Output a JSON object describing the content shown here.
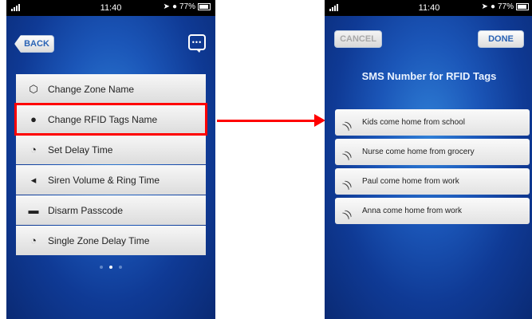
{
  "status_bar": {
    "time": "11:40",
    "battery": "77%"
  },
  "left_screen": {
    "back_label": "BACK",
    "chat_icon": "chat-bubble-icon",
    "menu_items": [
      {
        "label": "Change Zone Name",
        "icon": "zone-icon"
      },
      {
        "label": "Change RFID Tags Name",
        "icon": "person-icon"
      },
      {
        "label": "Set Delay Time",
        "icon": "clock-icon"
      },
      {
        "label": "Siren Volume & Ring Time",
        "icon": "speaker-icon"
      },
      {
        "label": "Disarm Passcode",
        "icon": "lock-icon"
      },
      {
        "label": "Single Zone Delay Time",
        "icon": "clock-icon"
      }
    ],
    "page_dots": 3,
    "active_dot": 1
  },
  "right_screen": {
    "cancel_label": "CANCEL",
    "done_label": "DONE",
    "title": "SMS Number for RFID Tags",
    "tags": [
      {
        "label": "Kids come home from school",
        "icon": "rfid-signal-icon"
      },
      {
        "label": "Nurse come home from grocery",
        "icon": "rfid-signal-icon"
      },
      {
        "label": "Paul come home from work",
        "icon": "rfid-signal-icon"
      },
      {
        "label": "Anna come home from work",
        "icon": "rfid-signal-icon"
      }
    ]
  },
  "colors": {
    "highlight": "#ff0000",
    "arrow": "#ff0000",
    "accent": "#2a63b5"
  }
}
